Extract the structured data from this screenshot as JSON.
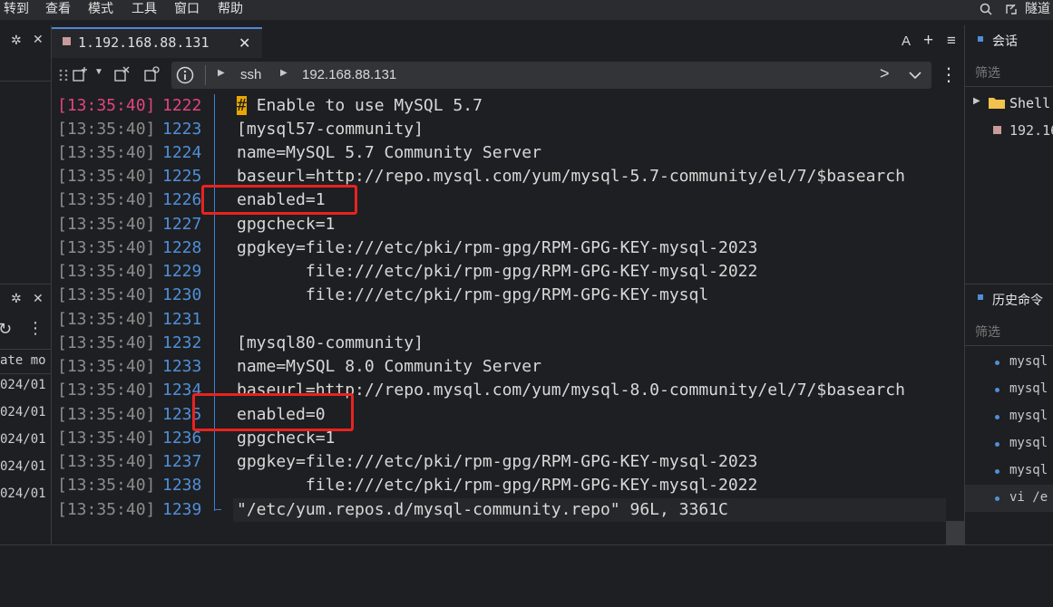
{
  "menu": {
    "items": [
      "转到",
      "查看",
      "模式",
      "工具",
      "窗口",
      "帮助"
    ],
    "right_label": "隧道"
  },
  "tab": {
    "label": "1.192.168.88.131"
  },
  "toolbar": {
    "path_segments": [
      "ssh",
      "192.168.88.131"
    ]
  },
  "tab_actions": {
    "font": "A",
    "add": "+",
    "menu": "≡"
  },
  "terminal": {
    "lines": [
      {
        "ts": "[13:35:40]",
        "ln": "1222",
        "text": "Enable to use MySQL 5.7",
        "prefix": "#"
      },
      {
        "ts": "[13:35:40]",
        "ln": "1223",
        "text": "[mysql57-community]"
      },
      {
        "ts": "[13:35:40]",
        "ln": "1224",
        "text": "name=MySQL 5.7 Community Server"
      },
      {
        "ts": "[13:35:40]",
        "ln": "1225",
        "text": "baseurl=http://repo.mysql.com/yum/mysql-5.7-community/el/7/$basearch"
      },
      {
        "ts": "[13:35:40]",
        "ln": "1226",
        "text": "enabled=1"
      },
      {
        "ts": "[13:35:40]",
        "ln": "1227",
        "text": "gpgcheck=1"
      },
      {
        "ts": "[13:35:40]",
        "ln": "1228",
        "text": "gpgkey=file:///etc/pki/rpm-gpg/RPM-GPG-KEY-mysql-2023"
      },
      {
        "ts": "[13:35:40]",
        "ln": "1229",
        "text": "       file:///etc/pki/rpm-gpg/RPM-GPG-KEY-mysql-2022"
      },
      {
        "ts": "[13:35:40]",
        "ln": "1230",
        "text": "       file:///etc/pki/rpm-gpg/RPM-GPG-KEY-mysql"
      },
      {
        "ts": "[13:35:40]",
        "ln": "1231",
        "text": ""
      },
      {
        "ts": "[13:35:40]",
        "ln": "1232",
        "text": "[mysql80-community]"
      },
      {
        "ts": "[13:35:40]",
        "ln": "1233",
        "text": "name=MySQL 8.0 Community Server"
      },
      {
        "ts": "[13:35:40]",
        "ln": "1234",
        "text": "baseurl=http://repo.mysql.com/yum/mysql-8.0-community/el/7/$basearch"
      },
      {
        "ts": "[13:35:40]",
        "ln": "1235",
        "text": "enabled=0"
      },
      {
        "ts": "[13:35:40]",
        "ln": "1236",
        "text": "gpgcheck=1"
      },
      {
        "ts": "[13:35:40]",
        "ln": "1237",
        "text": "gpgkey=file:///etc/pki/rpm-gpg/RPM-GPG-KEY-mysql-2023"
      },
      {
        "ts": "[13:35:40]",
        "ln": "1238",
        "text": "       file:///etc/pki/rpm-gpg/RPM-GPG-KEY-mysql-2022"
      },
      {
        "ts": "[13:35:40]",
        "ln": "1239",
        "text": "\"/etc/yum.repos.d/mysql-community.repo\" 96L, 3361C"
      }
    ]
  },
  "left_panel": {
    "col_header": "ate mo",
    "rows": [
      "024/01",
      "024/01",
      "024/01",
      "024/01",
      "024/01"
    ]
  },
  "sessions": {
    "title": "会话",
    "filter": "筛选",
    "folder": "Shell",
    "host": "192.16"
  },
  "history": {
    "title": "历史命令",
    "filter": "筛选",
    "items": [
      "mysql",
      "mysql",
      "mysql",
      "mysql",
      "mysql",
      "vi /e"
    ]
  },
  "colors": {
    "accent": "#4f8fd8",
    "highlight_box": "#e8231f",
    "timestamp_active": "#e0457f",
    "cursor": "#e8a700"
  }
}
